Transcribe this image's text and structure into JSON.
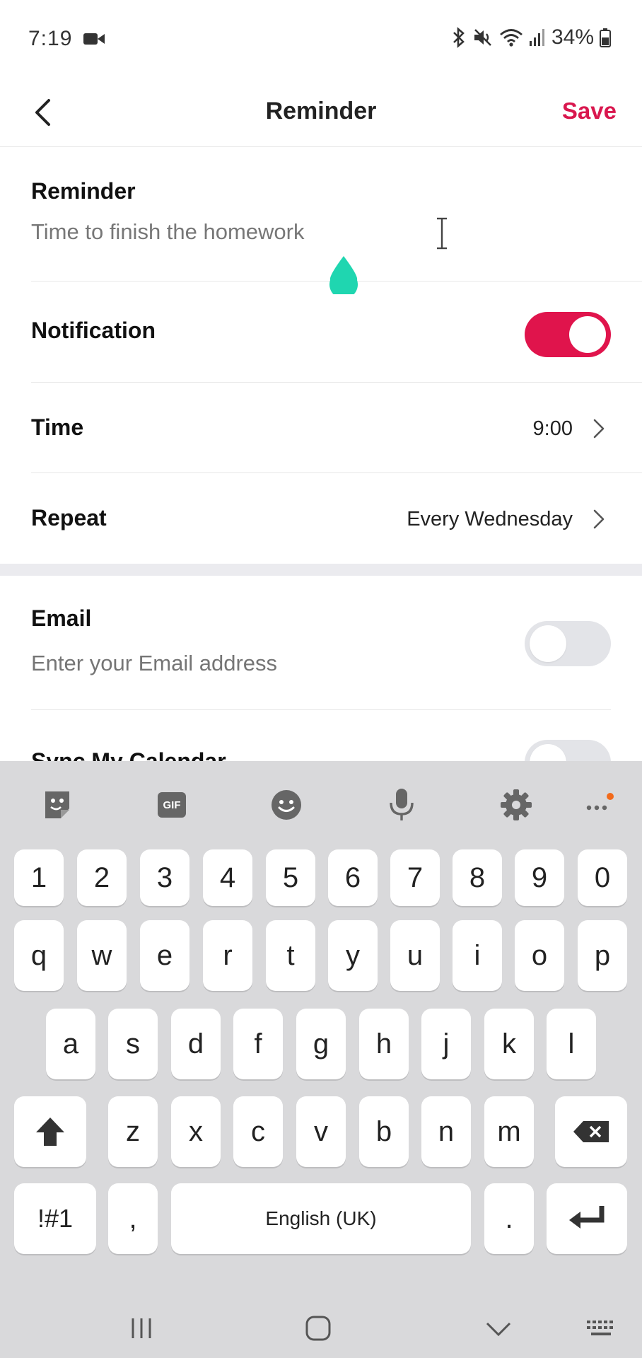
{
  "status_bar": {
    "time": "7:19",
    "battery": "34%",
    "icons": [
      "video-camera-icon",
      "bluetooth-icon",
      "mute-icon",
      "wifi-icon",
      "signal-icon",
      "battery-icon"
    ]
  },
  "header": {
    "title": "Reminder",
    "save_label": "Save",
    "back_icon": "chevron-left-icon"
  },
  "reminder": {
    "label": "Reminder",
    "value": "Time to finish the homework"
  },
  "notification": {
    "label": "Notification",
    "enabled": true
  },
  "time": {
    "label": "Time",
    "value": "9:00"
  },
  "repeat": {
    "label": "Repeat",
    "value": "Every Wednesday"
  },
  "email": {
    "label": "Email",
    "placeholder": "Enter your Email address",
    "enabled": false
  },
  "sync_calendar": {
    "label": "Sync My Calendar",
    "enabled": false
  },
  "keyboard": {
    "toolbar": [
      "sticker-icon",
      "gif-icon",
      "emoji-icon",
      "microphone-icon",
      "settings-icon",
      "more-icon"
    ],
    "gif_label": "GIF",
    "row_numbers": [
      "1",
      "2",
      "3",
      "4",
      "5",
      "6",
      "7",
      "8",
      "9",
      "0"
    ],
    "row_1": [
      "q",
      "w",
      "e",
      "r",
      "t",
      "y",
      "u",
      "i",
      "o",
      "p"
    ],
    "row_2": [
      "a",
      "s",
      "d",
      "f",
      "g",
      "h",
      "j",
      "k",
      "l"
    ],
    "row_3": [
      "z",
      "x",
      "c",
      "v",
      "b",
      "n",
      "m"
    ],
    "symbols_label": "!#1",
    "comma_label": ",",
    "space_label": "English (UK)",
    "period_label": "."
  },
  "colors": {
    "accent": "#e0144c",
    "save": "#d9174e",
    "cursor_drop": "#1fd6b0",
    "keyboard_bg": "#d9d9db"
  }
}
